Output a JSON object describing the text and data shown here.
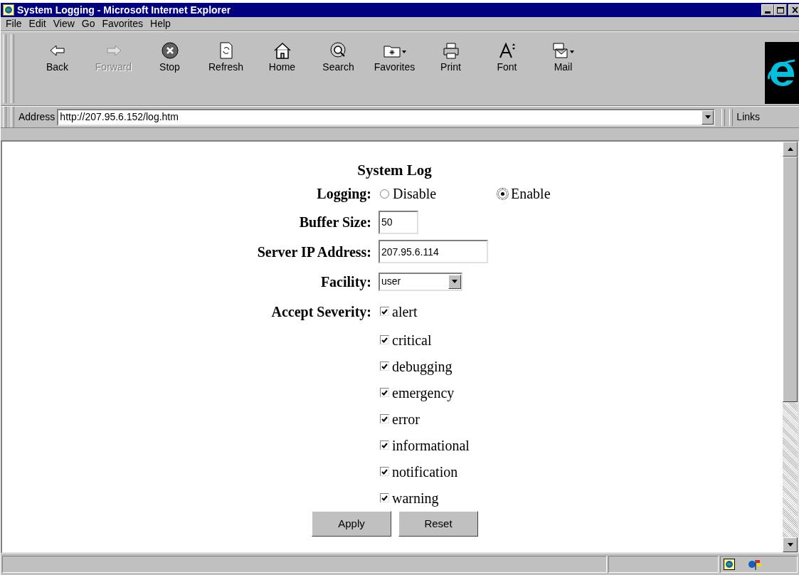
{
  "window": {
    "title": "System Logging - Microsoft Internet Explorer"
  },
  "menu": [
    {
      "label": "File"
    },
    {
      "label": "Edit"
    },
    {
      "label": "View"
    },
    {
      "label": "Go"
    },
    {
      "label": "Favorites"
    },
    {
      "label": "Help"
    }
  ],
  "toolbar": [
    {
      "kind": "back",
      "label": "Back",
      "disabled": false
    },
    {
      "kind": "forward",
      "label": "Forward",
      "disabled": true
    },
    {
      "kind": "stop",
      "label": "Stop",
      "disabled": false
    },
    {
      "kind": "refresh",
      "label": "Refresh",
      "disabled": false
    },
    {
      "kind": "home",
      "label": "Home",
      "disabled": false
    },
    {
      "kind": "search",
      "label": "Search",
      "disabled": false
    },
    {
      "kind": "favorites",
      "label": "Favorites",
      "disabled": false
    },
    {
      "kind": "print",
      "label": "Print",
      "disabled": false
    },
    {
      "kind": "font",
      "label": "Font",
      "disabled": false
    },
    {
      "kind": "mail",
      "label": "Mail",
      "disabled": false
    }
  ],
  "address_bar": {
    "label": "Address",
    "value": "http://207.95.6.152/log.htm",
    "links": "Links"
  },
  "page": {
    "title": "System Log",
    "logging": {
      "label": "Logging:",
      "options": [
        {
          "label": "Disable",
          "selected": false
        },
        {
          "label": "Enable",
          "selected": true
        }
      ]
    },
    "buffer_size": {
      "label": "Buffer Size:",
      "value": "50"
    },
    "server_ip": {
      "label": "Server IP Address:",
      "value": "207.95.6.114"
    },
    "facility": {
      "label": "Facility:",
      "value": "user"
    },
    "severity": {
      "label": "Accept Severity:",
      "items": [
        {
          "label": "alert",
          "checked": true
        },
        {
          "label": "critical",
          "checked": true
        },
        {
          "label": "debugging",
          "checked": true
        },
        {
          "label": "emergency",
          "checked": true
        },
        {
          "label": "error",
          "checked": true
        },
        {
          "label": "informational",
          "checked": true
        },
        {
          "label": "notification",
          "checked": true
        },
        {
          "label": "warning",
          "checked": true
        }
      ]
    },
    "buttons": [
      "Apply",
      "Reset"
    ]
  }
}
